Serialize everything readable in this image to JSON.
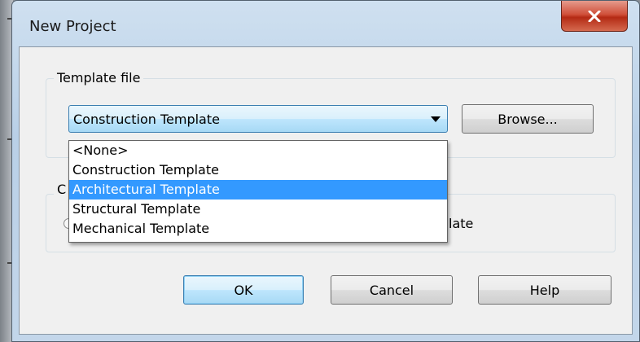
{
  "dialog": {
    "title": "New Project",
    "close_glyph": "X"
  },
  "template_group": {
    "label": "Template file",
    "combo_value": "Construction Template",
    "browse_label": "Browse...",
    "options": [
      "<None>",
      "Construction Template",
      "Architectural Template",
      "Structural Template",
      "Mechanical Template"
    ],
    "highlighted_option": "Architectural Template"
  },
  "create_group": {
    "label_partial": "C",
    "radio_text_partial": "late"
  },
  "buttons": {
    "ok": "OK",
    "cancel": "Cancel",
    "help": "Help"
  },
  "colors": {
    "selection": "#3399ff",
    "close_red": "#c7432b"
  }
}
